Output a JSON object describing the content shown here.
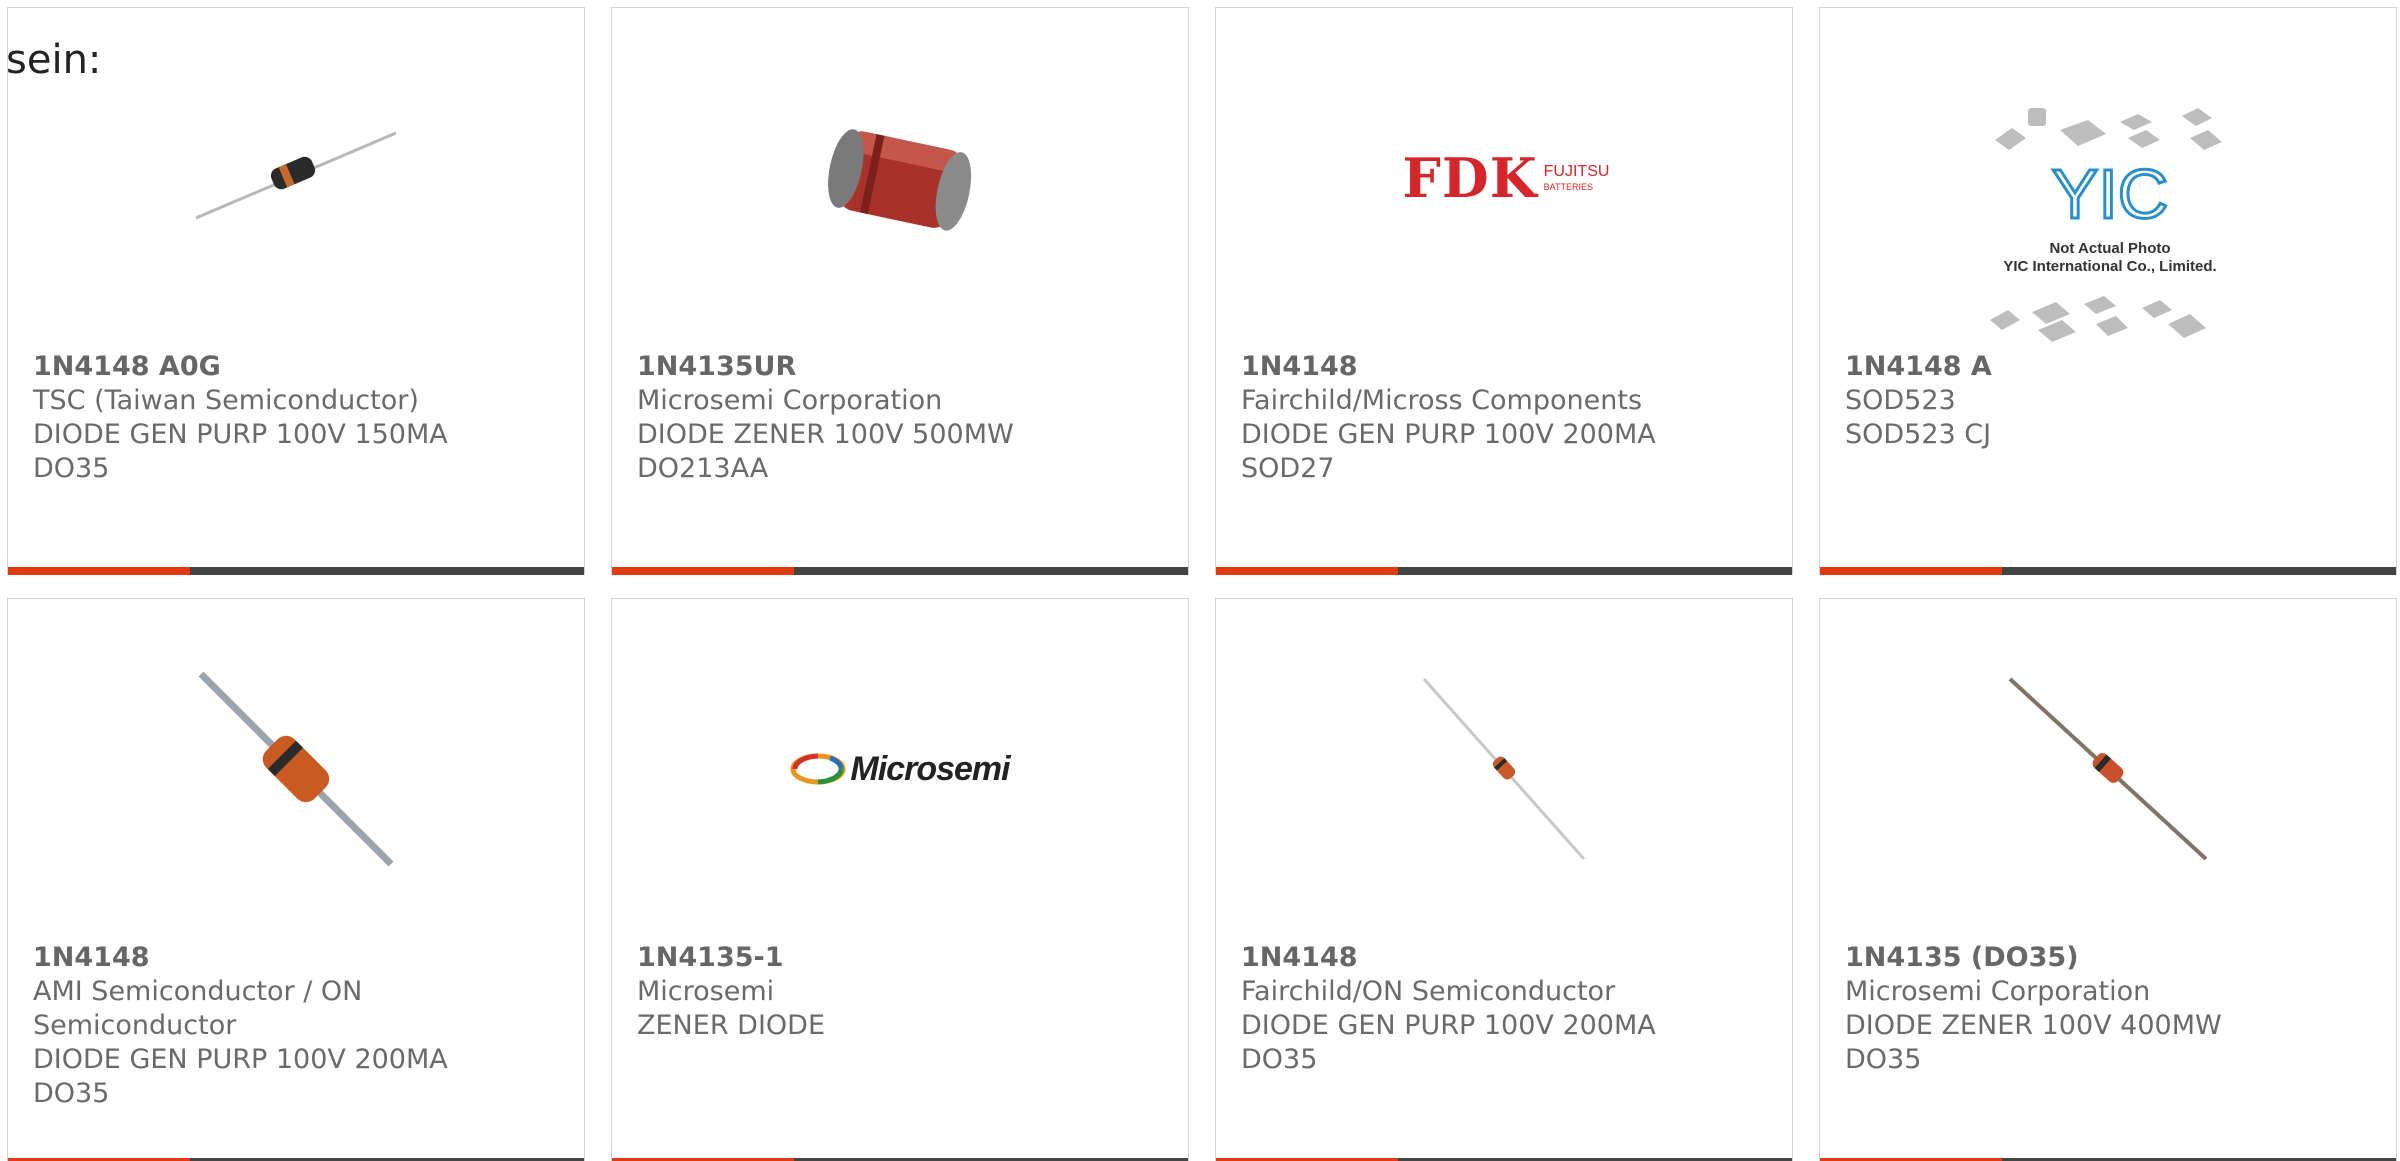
{
  "header": {
    "label": "sein:"
  },
  "colors": {
    "accent": "#e03a10",
    "bar": "#444444",
    "border": "#d4d4d4"
  },
  "cards": [
    {
      "part": "1N4148 A0G",
      "lines": [
        "TSC (Taiwan Semiconductor)",
        "DIODE GEN PURP 100V 150MA",
        "DO35"
      ],
      "image": "axial-diode-small"
    },
    {
      "part": "1N4135UR",
      "lines": [
        "Microsemi Corporation",
        "DIODE ZENER 100V 500MW",
        "DO213AA"
      ],
      "image": "melf-diode"
    },
    {
      "part": "1N4148",
      "lines": [
        "Fairchild/Micross Components",
        "DIODE GEN PURP 100V 200MA",
        "SOD27"
      ],
      "image": "fdk-fujitsu-logo",
      "logo": {
        "main": "FDK",
        "sub": "FUJITSU",
        "sub2": "BATTERIES"
      }
    },
    {
      "part": "1N4148 A",
      "lines": [
        "SOD523",
        "SOD523 CJ"
      ],
      "image": "yic-placeholder",
      "logo": {
        "mark": "YIC",
        "note1": "Not Actual Photo",
        "note2": "YIC International Co., Limited."
      }
    },
    {
      "part": "1N4148",
      "lines": [
        "AMI Semiconductor / ON",
        "Semiconductor",
        "DIODE GEN PURP 100V 200MA",
        "DO35"
      ],
      "image": "axial-diode-large"
    },
    {
      "part": "1N4135-1",
      "lines": [
        "Microsemi",
        "ZENER DIODE"
      ],
      "image": "microsemi-logo",
      "logo": {
        "main": "Microsemi"
      }
    },
    {
      "part": "1N4148",
      "lines": [
        "Fairchild/ON Semiconductor",
        "DIODE GEN PURP 100V 200MA",
        "DO35"
      ],
      "image": "axial-diode-thin"
    },
    {
      "part": "1N4135 (DO35)",
      "lines": [
        "Microsemi Corporation",
        "DIODE ZENER 100V 400MW",
        "DO35"
      ],
      "image": "axial-diode-diagonal"
    }
  ]
}
